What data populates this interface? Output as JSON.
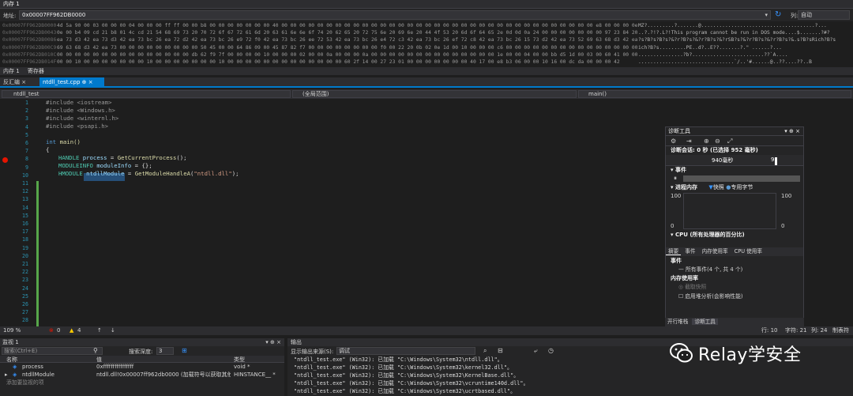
{
  "memory": {
    "title": "内存 1",
    "address_label": "地址:",
    "address": "0x00007FF962DB0000",
    "columns_label": "列:",
    "columns": "自动",
    "rows": [
      {
        "addr": "0x00007FF962DB0000",
        "hex": "4d 5a 90 00 03 00 00 00 04 00 00 00 ff ff 00 00 b8 00 00 00 00 00 00 00 40 00 00 00 00 00 00 00 00 00 00 00 00 00 00 00 00 00 00 00 00 00 00 00 00 00 00 00 00 00 00 00 00 00 00 00 e8 00 00 00 0e 1f ba",
        "ascii": "MZ?.........?.......@......................................?..."
      },
      {
        "addr": "0x00007FF962DB0043",
        "hex": "0e 00 b4 09 cd 21 b8 01 4c cd 21 54 68 69 73 20 70 72 6f 67 72 61 6d 20 63 61 6e 6e 6f 74 20 62 65 20 72 75 6e 20 69 6e 20 44 4f 53 20 6d 6f 64 65 2e 0d 0d 0a 24 00 00 00 00 00 00 00 97 23 84 20 d3 42",
        "ascii": "..?.?!?.L?!This program cannot be run in DOS mode....$.......?#?"
      },
      {
        "addr": "0x00007FF962DB0086",
        "hex": "ea 73 d3 42 ea 73 d3 42 ea 73 bc 26 ea 72 d2 42 ea 73 bc 26 e9 72 f0 42 ea 73 bc 26 ee 72 53 42 ea 73 bc 26 e4 72 c3 42 ea 73 bc 26 ef 72 c8 42 ea 73 bc 26 15 73 d2 42 ea 73 52 69 63 68 d3 42 ea 73",
        "ascii": "?s?B?s?B?s?&?r?B?s?&?r?B?s?&?rSB?s?&?r?B?s?&?r?B?s?&.s?B?sRich?B?s"
      },
      {
        "addr": "0x00007FF962DB00C9",
        "hex": "69 63 68 d3 42 ea 73 00 00 00 00 00 00 00 00 00 50 45 00 00 64 86 09 00 45 87 82 f7 00 00 00 00 00 00 00 00 f0 00 22 20 0b 02 0e 1d 00 10 00 00 00 c6 00 00 00 00 00 00 00 00 00 00 00 00 00 00 00 00 00",
        "ascii": "ich?B?s.........PE..d?..E??.......?.\" ......?..."
      },
      {
        "addr": "0x00007FF962DB010C",
        "hex": "00 00 00 00 00 00 00 00 00 00 00 00 00 00 00 db 62 f9 7f 00 00 00 00 10 00 00 00 02 00 00 0a 00 00 00 0a 00 00 00 00 00 00 00 00 00 00 00 00 00 00 1e 00 00 04 00 00 bb d5 1d 00 03 00 60 41 00 00 04 00 00",
        "ascii": "...............?b?........................??`A...."
      },
      {
        "addr": "0x00007FF962DB014F",
        "hex": "00 00 10 00 00 00 00 00 00 00 10 00 00 00 00 00 00 00 10 00 00 00 00 00 00 00 00 00 00 00 00 00 60 2f 14 00 27 23 01 00 00 00 00 00 00 00 40 17 00 e8 b3 06 00 00 10 16 00 dc da 00 00 00 42",
        "ascii": "................................`/..'#......@..??....??..B"
      }
    ],
    "tabs": [
      "内存 1",
      "寄存器"
    ]
  },
  "editor": {
    "tabs": [
      "反汇编",
      "ntdll_test.cpp"
    ],
    "nav_project": "ntdll_test",
    "nav_scope": "(全局范围)",
    "nav_member": "main()",
    "line_numbers": [
      "1",
      "2",
      "3",
      "4",
      "5",
      "6",
      "7",
      "8",
      "9",
      "10",
      "11",
      "12",
      "13",
      "14",
      "15",
      "16",
      "17",
      "18",
      "19",
      "20",
      "21",
      "22",
      "23",
      "24",
      "25",
      "26",
      "27",
      "28"
    ],
    "inc1": "#include <iostream>",
    "inc2": "#include <Windows.h>",
    "inc3": "#include <winternl.h>",
    "inc4": "#include <psapi.h>",
    "l6_kw": "int",
    "l6_fn": " main()",
    "l7": "{",
    "l8_typ": "HANDLE",
    "l8_var": " process",
    "l8_rest": " = ",
    "l8_fn": "GetCurrentProcess",
    "l8_end": "();",
    "l9_typ": "MODULEINFO",
    "l9_var": " moduleInfo",
    "l9_end": " = {};",
    "l10_typ": "HMODULE",
    "l10_var": "ntdllModule",
    "l10_eq": " = ",
    "l10_fn": "GetModuleHandleA",
    "l10_str": "\"ntdll.dll\"",
    "l10_end": ");",
    "l10_open": "("
  },
  "status": {
    "zoom": "109 %",
    "errors": "0",
    "warnings": "4",
    "line": "行: 10",
    "char": "字符: 21",
    "col": "列: 24",
    "tabs": "制表符"
  },
  "diag": {
    "title": "诊断工具",
    "session": "诊断会话: 0 秒 (已选择 952 毫秒)",
    "timeline_label": "940毫秒",
    "timeline_label2": "9",
    "events": "事件",
    "process_mem": "进程内存",
    "snapshot": "快照",
    "private_bytes": "专用字节",
    "axis_max": "100",
    "axis_zero": "0",
    "cpu": "CPU (所有处理器的百分比)",
    "tabs": [
      "摘要",
      "事件",
      "内存使用率",
      "CPU 使用率"
    ],
    "events_head": "事件",
    "all_events": "所有事件(4 个, 共 4 个)",
    "mem_usage": "内存使用率",
    "take_snapshot": "截取快照",
    "heap_analysis": "启用堆分析(会影响性能)",
    "bottom_tabs": [
      "开行堆栈",
      "诊断工具"
    ]
  },
  "watch": {
    "title": "监视 1",
    "search_placeholder": "搜索(Ctrl+E)",
    "depth_label": "搜索深度:",
    "depth": "3",
    "headers": [
      "名称",
      "值",
      "类型"
    ],
    "rows": [
      {
        "name": "process",
        "value": "0xffffffffffffffff",
        "type": "void *"
      },
      {
        "name": "ntdllModule",
        "value": "ntdll.dll!0x00007ff962db0000 (加载符号以获取其他...",
        "type": "HINSTANCE__ *"
      }
    ],
    "add_item": "添加要监视的项"
  },
  "output": {
    "title": "输出",
    "source_label": "显示输出来源(S):",
    "source": "调试",
    "lines": [
      "\"ntdll_test.exe\" (Win32): 已加载 \"C:\\Windows\\System32\\ntdll.dll\"。",
      "\"ntdll_test.exe\" (Win32): 已加载 \"C:\\Windows\\System32\\kernel32.dll\"。",
      "\"ntdll_test.exe\" (Win32): 已加载 \"C:\\Windows\\System32\\KernelBase.dll\"。",
      "\"ntdll_test.exe\" (Win32): 已加载 \"C:\\Windows\\System32\\vcruntime140d.dll\"。",
      "\"ntdll_test.exe\" (Win32): 已加载 \"C:\\Windows\\System32\\ucrtbased.dll\"。"
    ]
  },
  "watermark": {
    "text": "Relay学安全"
  }
}
